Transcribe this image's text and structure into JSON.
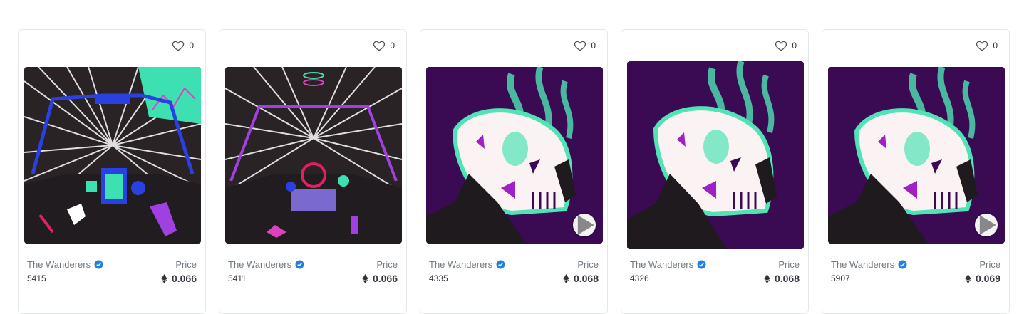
{
  "cards": [
    {
      "likes": "0",
      "collection": "The Wanderers",
      "token_id": "5415",
      "price_label": "Price",
      "price": "0.066",
      "art": "cockpit-hyperspace"
    },
    {
      "likes": "0",
      "collection": "The Wanderers",
      "token_id": "5411",
      "price_label": "Price",
      "price": "0.066",
      "art": "cockpit-hyperspace"
    },
    {
      "likes": "0",
      "collection": "The Wanderers",
      "token_id": "4335",
      "price_label": "Price",
      "price": "0.068",
      "art": "smoking-skull"
    },
    {
      "likes": "0",
      "collection": "The Wanderers",
      "token_id": "4326",
      "price_label": "Price",
      "price": "0.068",
      "art": "smoking-skull"
    },
    {
      "likes": "0",
      "collection": "The Wanderers",
      "token_id": "5907",
      "price_label": "Price",
      "price": "0.069",
      "art": "smoking-skull"
    }
  ],
  "colors": {
    "verified": "#2081e2",
    "skull_bg": "#3a0a52",
    "mint": "#4fe3b5",
    "magenta": "#a020c8"
  }
}
